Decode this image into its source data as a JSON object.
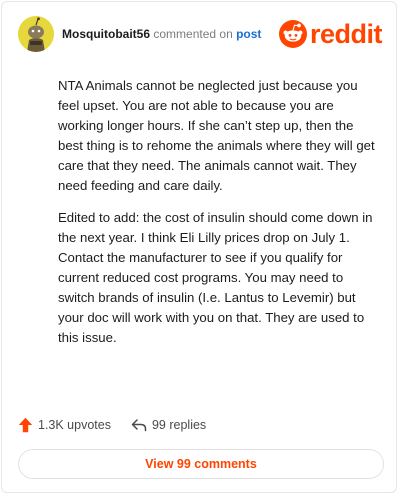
{
  "comment": {
    "username": "Mosquitobait56",
    "action_text": "commented on",
    "target_text": "post",
    "brand": "reddit",
    "paragraphs": [
      "NTA Animals cannot be neglected just because you feel upset. You are not able to because you are working longer hours. If she can’t step up, then the best thing is to rehome the animals where they will get care that they need. The animals cannot wait. They need feeding and care daily.",
      "Edited to add: the cost of insulin should come down in the next year. I think Eli Lilly prices drop on July 1. Contact the manufacturer to see if you qualify for current reduced cost programs. You may need to switch brands of insulin (I.e. Lantus to Levemir) but your doc will work with you on that. They are used to this issue."
    ]
  },
  "actions": {
    "upvotes": "1.3K upvotes",
    "replies": "99 replies",
    "view_comments": "View 99 comments"
  },
  "icons": {
    "avatar": "snoo-avatar-icon",
    "logo": "reddit-logo-icon",
    "upvote": "upvote-arrow-icon",
    "reply": "reply-arrow-icon"
  },
  "colors": {
    "brand": "#ff4500",
    "link": "#1c6fd1",
    "avatar_bg": "#e6d83c",
    "text": "#1c1c1c",
    "muted": "#7c7c7c"
  }
}
